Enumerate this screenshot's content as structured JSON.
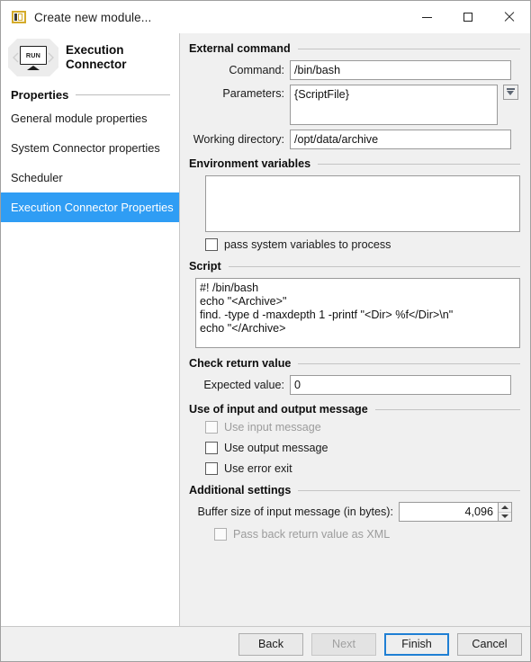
{
  "window": {
    "title": "Create new module...",
    "icon": "module-icon",
    "controls": {
      "minimize": "minimize-icon",
      "maximize": "maximize-icon",
      "close": "close-icon"
    }
  },
  "sidebar": {
    "module": {
      "icon_label": "RUN",
      "name_line1": "Execution",
      "name_line2": "Connector"
    },
    "section_label": "Properties",
    "items": [
      {
        "label": "General module properties",
        "selected": false
      },
      {
        "label": "System Connector properties",
        "selected": false
      },
      {
        "label": "Scheduler",
        "selected": false
      },
      {
        "label": "Execution Connector Properties",
        "selected": true
      }
    ],
    "selected_color": "#2f9df4"
  },
  "main": {
    "external_command": {
      "title": "External command",
      "command_label": "Command:",
      "command_value": "/bin/bash",
      "parameters_label": "Parameters:",
      "parameters_value": "{ScriptFile}",
      "parameters_dropdown_icon": "insert-variable-icon",
      "working_dir_label": "Working directory:",
      "working_dir_value": "/opt/data/archive"
    },
    "environment_variables": {
      "title": "Environment variables",
      "value": "",
      "pass_system_label": "pass system variables to process",
      "pass_system_checked": false
    },
    "script": {
      "title": "Script",
      "value": "#! /bin/bash\necho \"<Archive>\"\nfind. -type d -maxdepth 1 -printf \"<Dir> %f</Dir>\\n\"\necho \"</Archive>"
    },
    "check_return_value": {
      "title": "Check return value",
      "expected_label": "Expected value:",
      "expected_value": "0"
    },
    "messages": {
      "title": "Use of input and output message",
      "options": [
        {
          "label": "Use input message",
          "checked": false,
          "disabled": true
        },
        {
          "label": "Use output message",
          "checked": false,
          "disabled": false
        },
        {
          "label": "Use error exit",
          "checked": false,
          "disabled": false
        }
      ]
    },
    "additional_settings": {
      "title": "Additional settings",
      "buffer_label": "Buffer size of input message (in bytes):",
      "buffer_value": "4,096",
      "pass_back_label": "Pass back return value as XML",
      "pass_back_checked": false,
      "pass_back_disabled": true
    }
  },
  "footer": {
    "back": "Back",
    "next": "Next",
    "finish": "Finish",
    "cancel": "Cancel"
  }
}
